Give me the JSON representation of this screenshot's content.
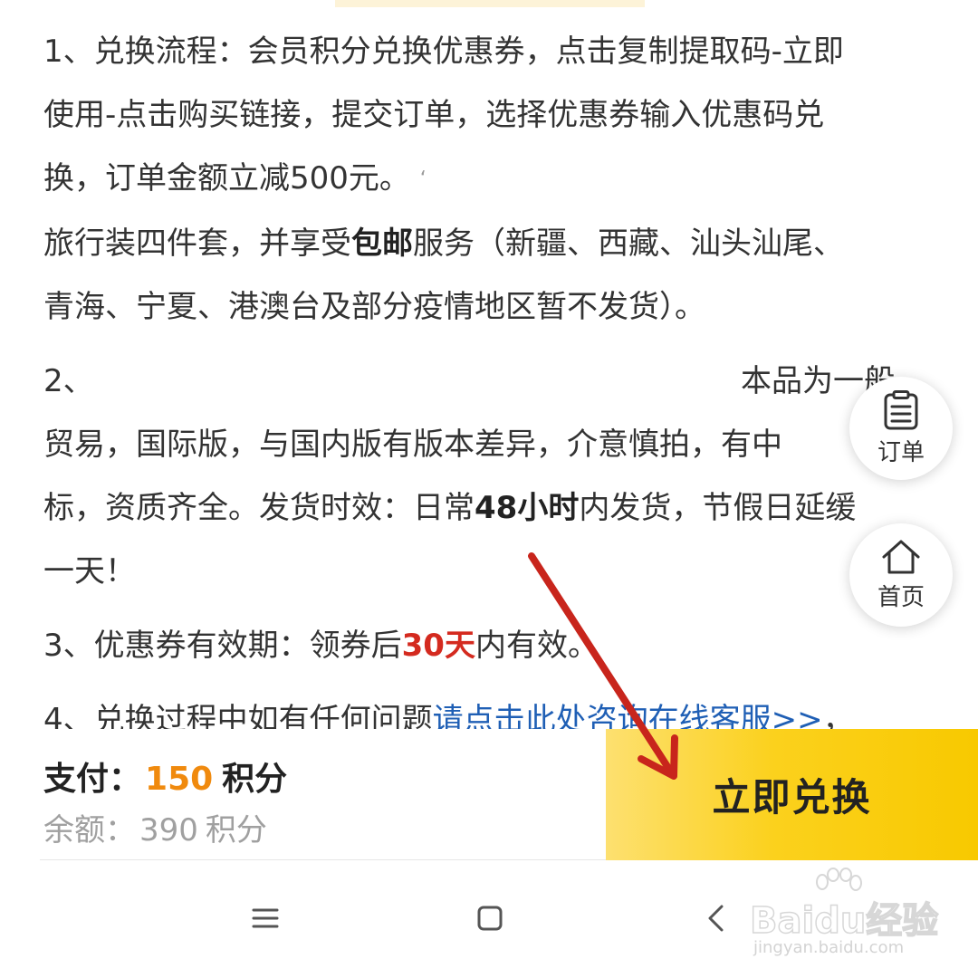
{
  "content": {
    "p1": {
      "line1": "1、兑换流程：会员积分兑换优惠券，点击复制提取码-立即",
      "line2": "使用-点击购买链接，提交订单，选择优惠券输入优惠码兑",
      "line3": "换，订单金额立减500元。",
      "line4_a": "旅行装四件套，并享受",
      "line4_bold": "包邮",
      "line4_b": "服务（新疆、西藏、汕头汕尾、",
      "line5": "青海、宁夏、港澳台及部分疫情地区暂不发货）。"
    },
    "p2": {
      "index": "2、",
      "right": "本品为一般",
      "line2": "贸易，国际版，与国内版有版本差异，介意慎拍，有中",
      "line3_a": "标，资质齐全。发货时效：日常",
      "line3_bold": "48小时",
      "line3_b": "内发货，节假日延缓",
      "line4": "一天！"
    },
    "p3": {
      "a": "3、优惠券有效期：领券后",
      "red": "30天",
      "b": "内有效。"
    },
    "p4": {
      "a": "4、兑换过程中如有任何问题",
      "link": "请点击此处咨询在线客服>>",
      "b": "，"
    }
  },
  "fab": {
    "orders_label": "订单",
    "home_label": "首页",
    "orders_icon": "clipboard-list-icon",
    "home_icon": "house-icon"
  },
  "bottom": {
    "pay_label": "支付：",
    "pay_amount": "150",
    "pay_unit": "积分",
    "balance_label": "余额：",
    "balance_amount": "390",
    "balance_unit": "积分",
    "redeem_button": "立即兑换"
  },
  "navbar": {
    "menu_icon": "menu-lines-icon",
    "home_icon": "square-home-icon",
    "back_icon": "chevron-left-icon"
  },
  "watermark": {
    "brand": "Baidu经验",
    "url": "jingyan.baidu.com"
  },
  "colors": {
    "accent_button": "#fbd11d",
    "price": "#f08a0e",
    "highlight_red": "#d42a1f",
    "link": "#1f5fb5",
    "annotation_arrow": "#c8251c"
  }
}
